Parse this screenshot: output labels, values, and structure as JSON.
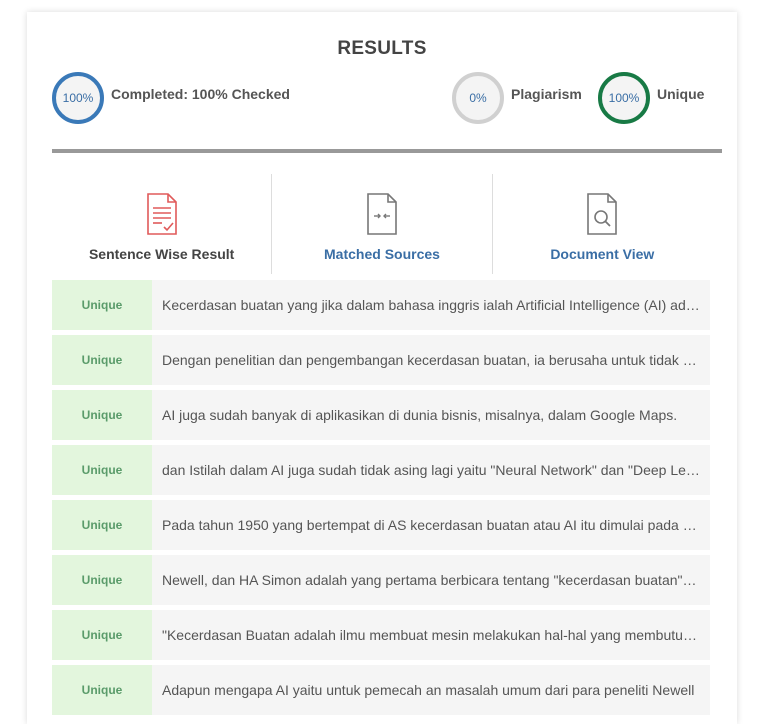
{
  "results": {
    "title": "RESULTS",
    "completed": {
      "ring": "100%",
      "label": "Completed: 100% Checked"
    },
    "plagiarism": {
      "ring": "0%",
      "label": "Plagiarism"
    },
    "unique": {
      "ring": "100%",
      "label": "Unique"
    }
  },
  "tabs": [
    {
      "label": "Sentence Wise Result",
      "icon": "document-check-icon"
    },
    {
      "label": "Matched Sources",
      "icon": "compare-file-icon"
    },
    {
      "label": "Document View",
      "icon": "document-search-icon"
    }
  ],
  "rows": [
    {
      "badge": "Unique",
      "text": "Kecerdasan buatan yang jika dalam bahasa inggris ialah Artificial Intelligence (AI) adalah"
    },
    {
      "badge": "Unique",
      "text": "Dengan penelitian dan pengembangan kecerdasan buatan, ia berusaha untuk tidak hanya"
    },
    {
      "badge": "Unique",
      "text": "AI juga sudah banyak di aplikasikan di dunia bisnis, misalnya, dalam Google Maps."
    },
    {
      "badge": "Unique",
      "text": "dan Istilah dalam AI juga sudah tidak asing lagi yaitu \"Neural Network\" dan \"Deep Learning\""
    },
    {
      "badge": "Unique",
      "text": "Pada tahun 1950 yang bertempat di AS kecerdasan buatan atau AI itu dimulai pada saat"
    },
    {
      "badge": "Unique",
      "text": "Newell, dan HA Simon adalah yang pertama berbicara tentang \"kecerdasan buatan\" pada"
    },
    {
      "badge": "Unique",
      "text": "\"Kecerdasan Buatan adalah ilmu membuat mesin melakukan hal-hal yang membutuhkan"
    },
    {
      "badge": "Unique",
      "text": "Adapun mengapa AI yaitu untuk pemecah an masalah umum dari para peneliti Newell"
    }
  ]
}
